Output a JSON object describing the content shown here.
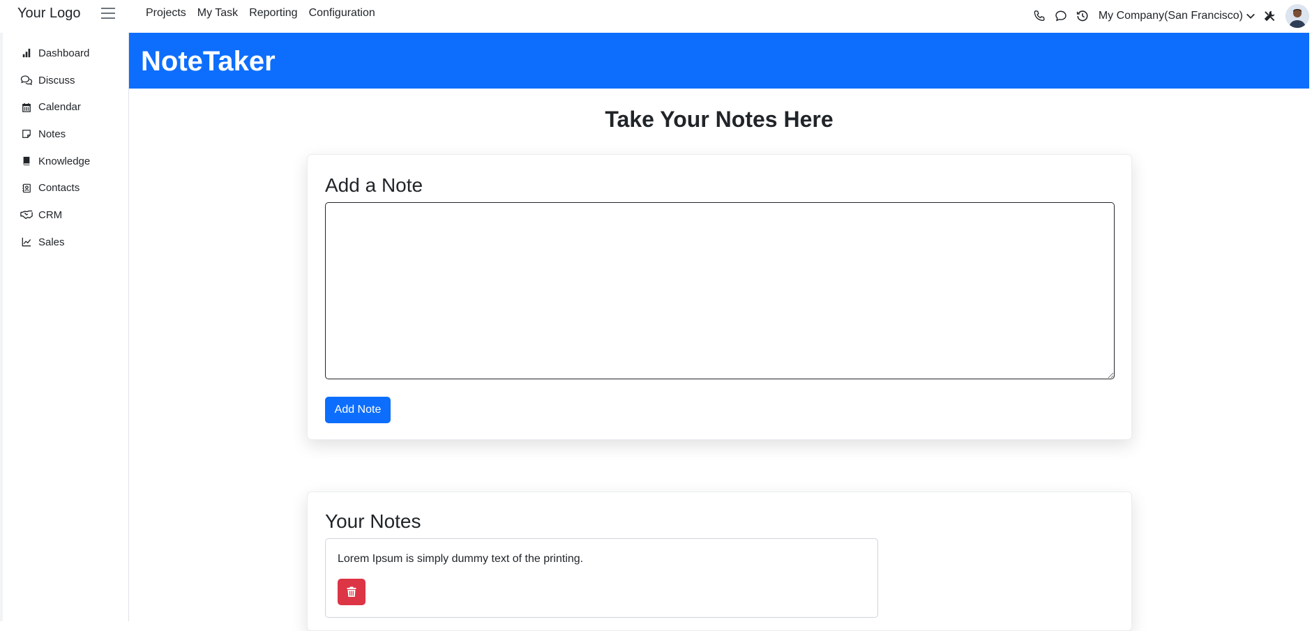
{
  "header": {
    "logo": "Your Logo",
    "nav": [
      "Projects",
      "My Task",
      "Reporting",
      "Configuration"
    ],
    "company": "My Company(San Francisco)",
    "icons": [
      "phone-icon",
      "chat-icon",
      "history-icon",
      "tools-icon"
    ]
  },
  "sidebar": {
    "items": [
      {
        "label": "Dashboard",
        "icon": "bar-chart-icon"
      },
      {
        "label": "Discuss",
        "icon": "chat-bubbles-icon"
      },
      {
        "label": "Calendar",
        "icon": "calendar-icon"
      },
      {
        "label": "Notes",
        "icon": "note-icon"
      },
      {
        "label": "Knowledge",
        "icon": "book-icon"
      },
      {
        "label": "Contacts",
        "icon": "contact-card-icon"
      },
      {
        "label": "CRM",
        "icon": "handshake-icon"
      },
      {
        "label": "Sales",
        "icon": "line-chart-icon"
      }
    ]
  },
  "banner": {
    "title": "NoteTaker",
    "color": "#0d6efd"
  },
  "main": {
    "title": "Take Your Notes Here",
    "add_card": {
      "heading": "Add a Note",
      "textarea_value": "",
      "button_label": "Add Note"
    },
    "notes_card": {
      "heading": "Your Notes",
      "notes": [
        {
          "text": "Lorem Ipsum is simply dummy text of the printing."
        }
      ]
    }
  },
  "colors": {
    "primary": "#0d6efd",
    "danger": "#dc3545"
  }
}
